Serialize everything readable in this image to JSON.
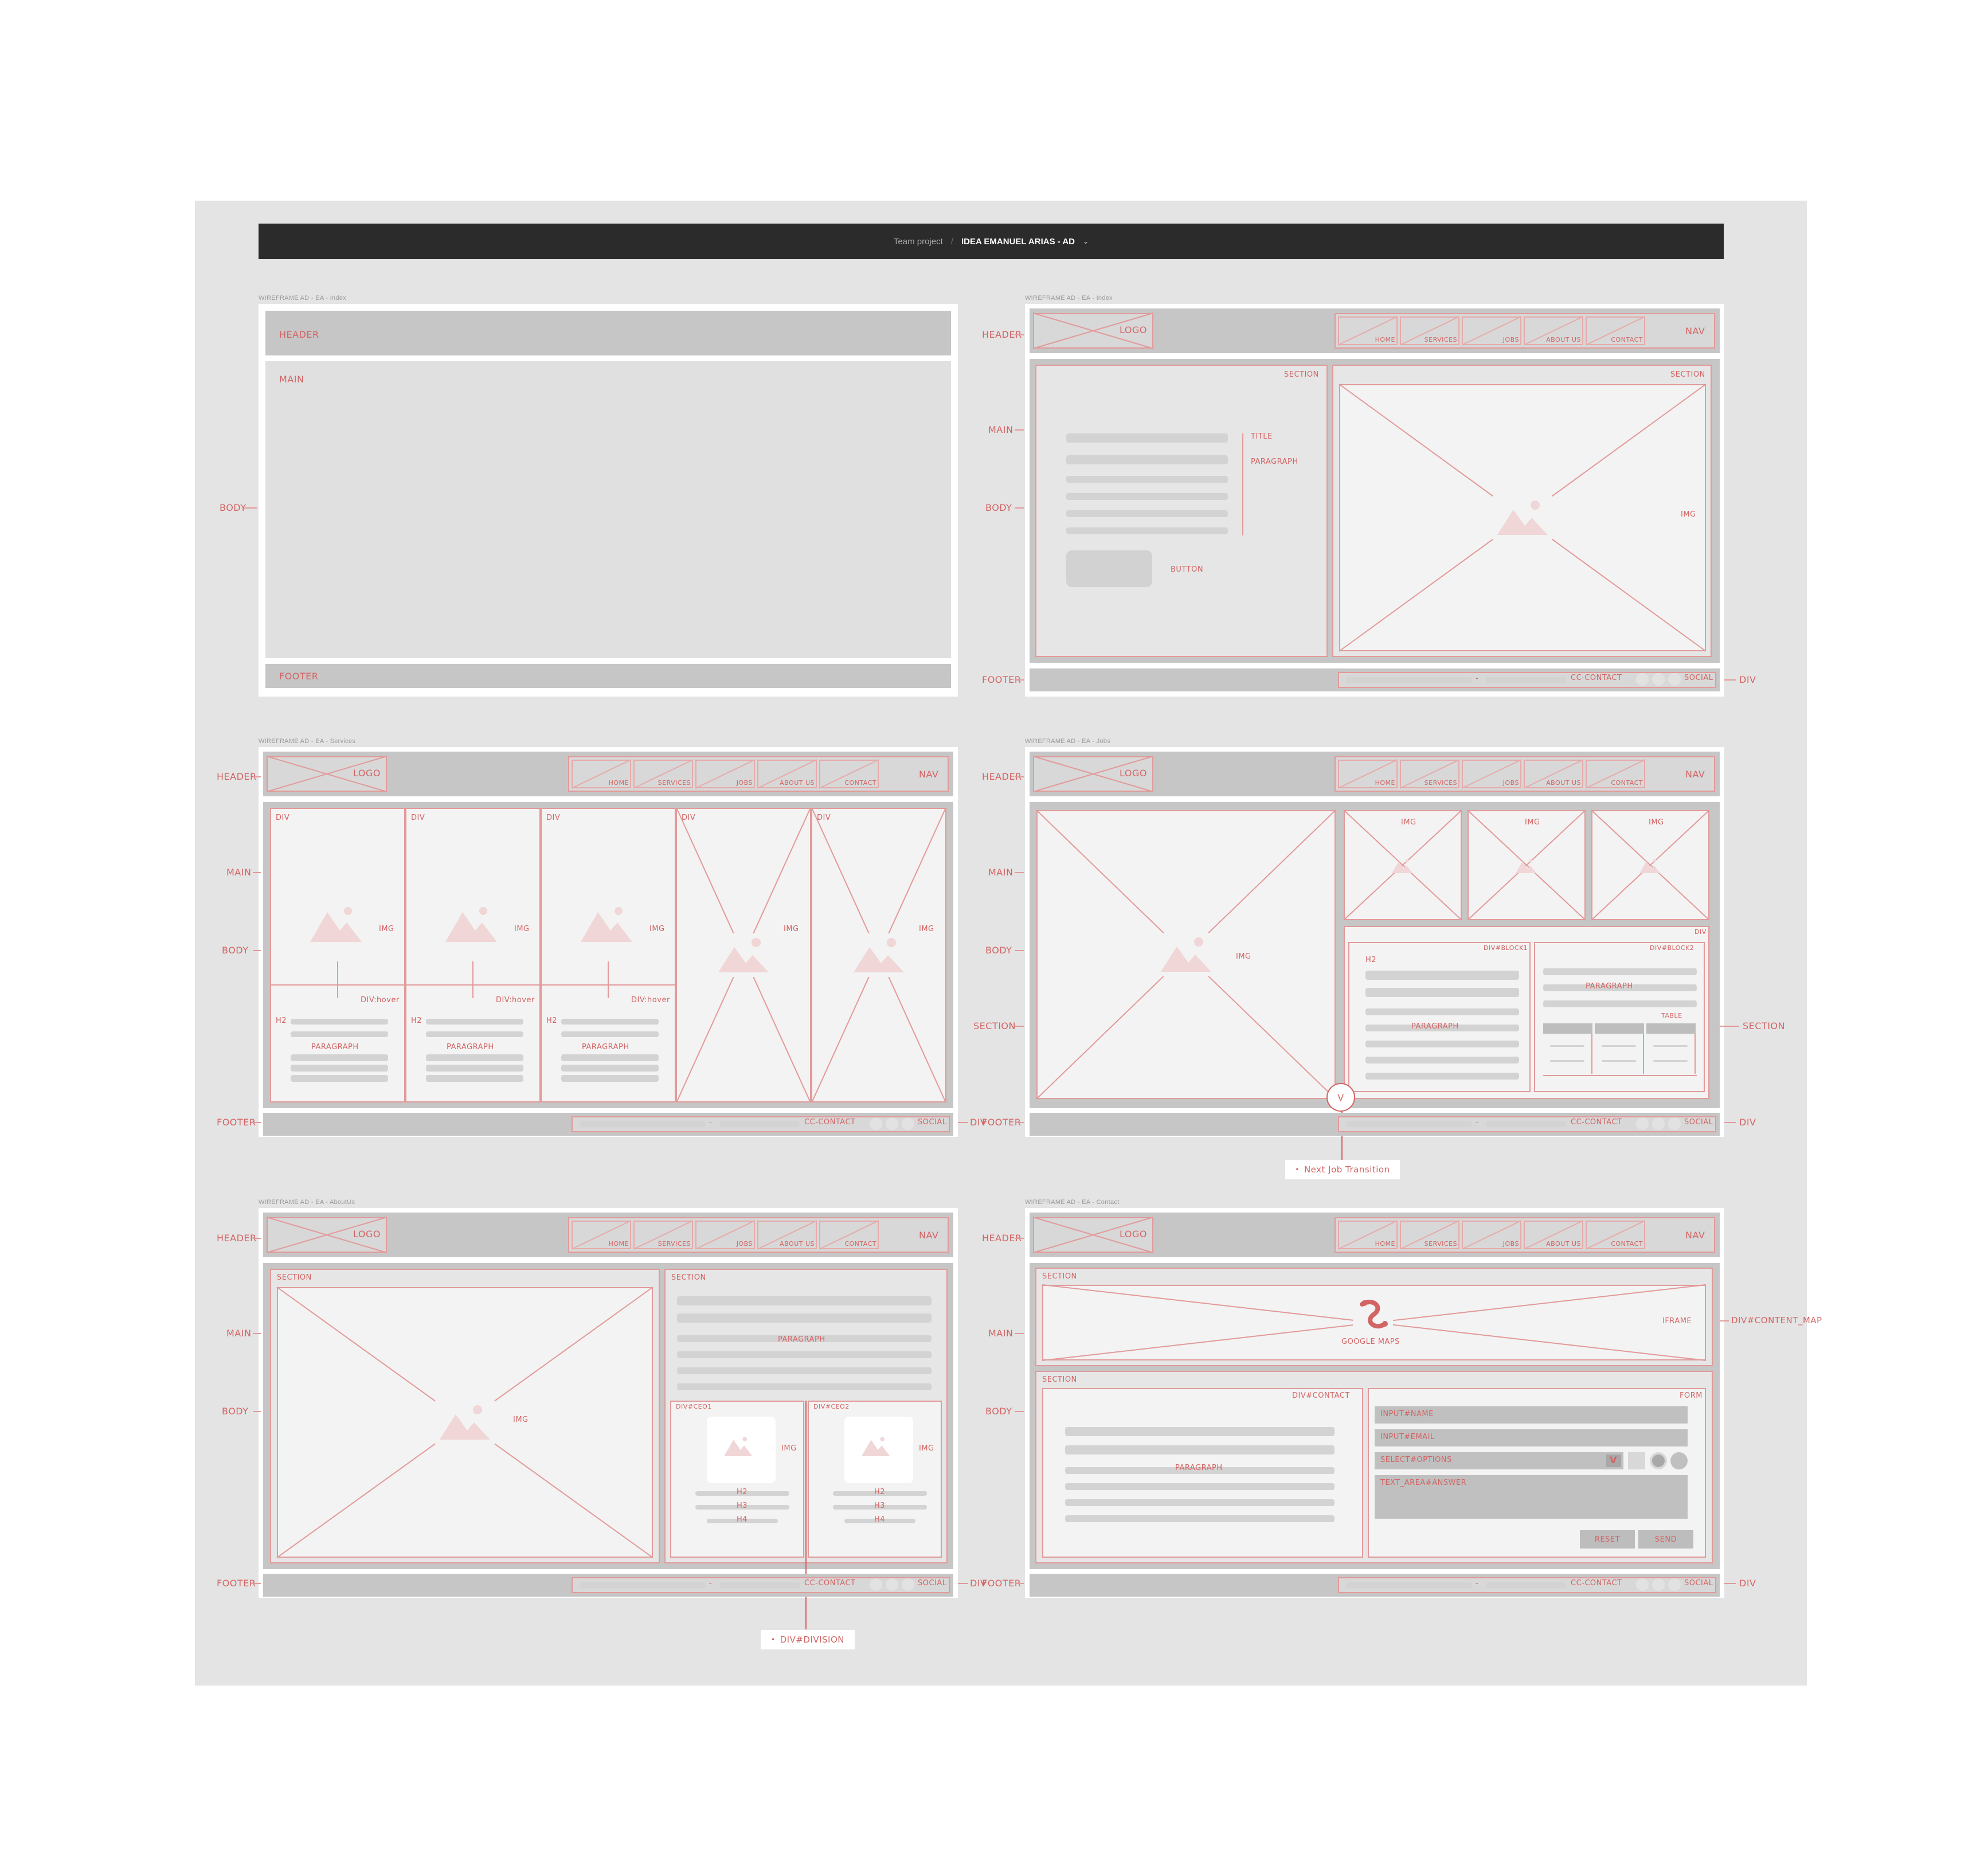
{
  "header": {
    "team": "Team project",
    "separator": "/",
    "project": "IDEA EMANUEL ARIAS - AD"
  },
  "frames": {
    "index": "WIREFRAME AD - EA - Index",
    "index2": "WIREFRAME AD - EA - Index",
    "services": "WIREFRAME AD - EA - Services",
    "jobs": "WIREFRAME AD - EA - Jobs",
    "aboutus": "WIREFRAME AD - EA - AboutUs",
    "contact": "WIREFRAME AD - EA - Contact"
  },
  "labels": {
    "header": "HEADER",
    "main": "MAIN",
    "footer": "FOOTER",
    "body": "BODY",
    "section": "SECTION",
    "logo": "LOGO",
    "nav": "NAV",
    "div": "DIV",
    "img": "IMG",
    "title": "TITLE",
    "paragraph": "PARAGRAPH",
    "button": "BUTTON",
    "cc_contact": "CC-CONTACT",
    "social": "SOCIAL",
    "div_hover": "DIV:hover",
    "h2": "H2",
    "h3": "H3",
    "h4": "H4",
    "div_block1": "DIV#BLOCK1",
    "div_block2": "DIV#BLOCK2",
    "table": "TABLE",
    "div_ceo1": "DIV#CEO1",
    "div_ceo2": "DIV#CEO2",
    "iframe": "IFRAME",
    "google_maps": "GOOGLE MAPS",
    "div_content_map": "DIV#CONTENT_MAP",
    "div_contact": "DIV#CONTACT",
    "form": "FORM",
    "input_name": "INPUT#NAME",
    "input_email": "INPUT#EMAIL",
    "select_options": "SELECT#OPTIONS",
    "text_area": "TEXT_AREA#ANSWER",
    "reset": "RESET",
    "send": "SEND",
    "select_v": "V",
    "transition_v": "V",
    "dash": "-"
  },
  "nav_items": [
    "HOME",
    "SERVICES",
    "JOBS",
    "ABOUT US",
    "CONTACT"
  ],
  "annotations": {
    "next_job": "Next Job Transition",
    "div_division": "DIV#DIVISION"
  },
  "colors": {
    "accent": "#d36464",
    "dark_bar": "#2b2b2b",
    "canvas": "#e4e4e4",
    "panel": "#c6c6c6"
  }
}
